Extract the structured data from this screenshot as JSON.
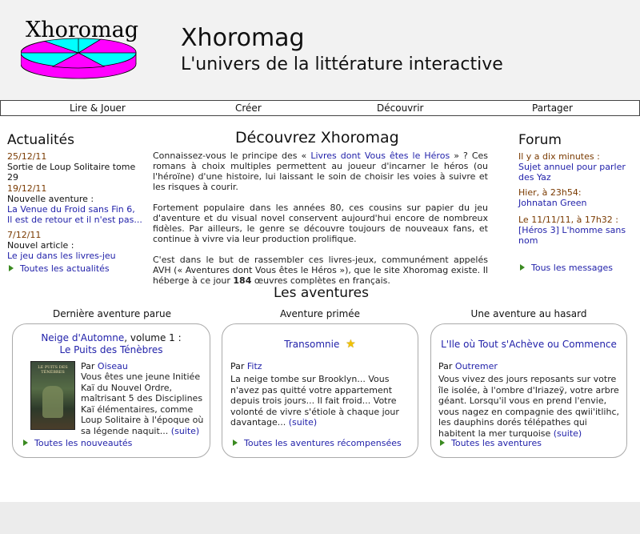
{
  "header": {
    "logo_text": "Xhoromag",
    "title": "Xhoromag",
    "subtitle": "L'univers de la littérature interactive"
  },
  "nav": {
    "items": [
      "Lire & Jouer",
      "Créer",
      "Découvrir",
      "Partager"
    ]
  },
  "news": {
    "heading": "Actualités",
    "items": [
      {
        "date": "25/12/11",
        "text": "Sortie de Loup Solitaire tome 29",
        "link1": "",
        "link2": ""
      },
      {
        "date": "19/12/11",
        "text": "Nouvelle aventure :",
        "link1": "La Venue du Froid sans Fin 6,",
        "link2": "Il est de retour et il n'est pas..."
      },
      {
        "date": "7/12/11",
        "text": "Nouvel article :",
        "link1": "Le jeu dans les livres-jeu",
        "link2": ""
      }
    ],
    "all_link": "Toutes les actualités"
  },
  "main": {
    "heading": "Découvrez Xhoromag",
    "p1_a": "Connaissez-vous le principe des «",
    "p1_link": "Livres dont Vous êtes le Héros",
    "p1_b": "» ? Ces romans à choix multiples permettent au joueur d'incarner le héros (ou l'héroïne) d'une histoire, lui laissant le soin de choisir les voies à suivre et les risques à courir.",
    "p2": "Fortement populaire dans les années 80, ces cousins sur papier du jeu d'aventure et du visual novel conservent aujourd'hui encore de nombreux fidèles. Par ailleurs, le genre se découvre toujours de nouveaux fans, et continue à vivre via leur production prolifique.",
    "p3_a": "C'est dans le but de rassembler ces livres-jeux, communément appelés AVH (« Aventures dont Vous êtes le Héros »), que le site Xhoromag existe. Il héberge à ce jour",
    "p3_count": "184",
    "p3_b": "œuvres complètes en français."
  },
  "forum": {
    "heading": "Forum",
    "items": [
      {
        "date": "Il y a dix minutes :",
        "link": "Sujet annuel pour parler des Yaz"
      },
      {
        "date": "Hier, à 23h54:",
        "link": "Johnatan Green"
      },
      {
        "date": "Le 11/11/11, à 17h32 :",
        "link": "[Héros 3] L'homme sans nom"
      }
    ],
    "all_link": "Tous les messages"
  },
  "adventures": {
    "heading": "Les aventures",
    "cards": [
      {
        "label": "Dernière aventure parue",
        "title_link": "Neige d'Automne",
        "title_rest": ", volume 1 :",
        "title_line2": "Le Puits des Ténèbres",
        "by": "Par",
        "author": "Oiseau",
        "cover_text": "LE PUITS DES TÉNÈBRES",
        "summary": "Vous êtes une jeune Initiée Kaï du Nouvel Ordre, maîtrisant 5 des Disciplines Kaï élémentaires, comme Loup Solitaire à l'époque où sa légende naquit...",
        "more": "(suite)",
        "footer_link": "Toutes les nouveautés"
      },
      {
        "label": "Aventure primée",
        "title_link": "Transomnie",
        "by": "Par",
        "author": "Fitz",
        "summary": "La neige tombe sur Brooklyn... Vous n'avez pas quitté votre appartement depuis trois jours... Il fait froid... Votre volonté de vivre s'étiole à chaque jour davantage...",
        "more": "(suite)",
        "footer_link": "Toutes les aventures récompensées"
      },
      {
        "label": "Une aventure au hasard",
        "title_link": "L'Ile où Tout s'Achève ou Commence",
        "by": "Par",
        "author": "Outremer",
        "summary": "Vous vivez des jours reposants sur votre île isolée, à l'ombre d'Iriazeÿ, votre arbre géant. Lorsqu'il vous en prend l'envie, vous nagez en compagnie des qwii'itlihc, les dauphins dorés télépathes qui habitent la mer turquoise",
        "more": "(suite)",
        "footer_link": "Toutes les aventures"
      }
    ]
  },
  "colors": {
    "link": "#2222aa",
    "date": "#7a3a00",
    "logo_magenta": "#ff00ff",
    "logo_cyan": "#00ffff",
    "star": "#f2c200"
  }
}
